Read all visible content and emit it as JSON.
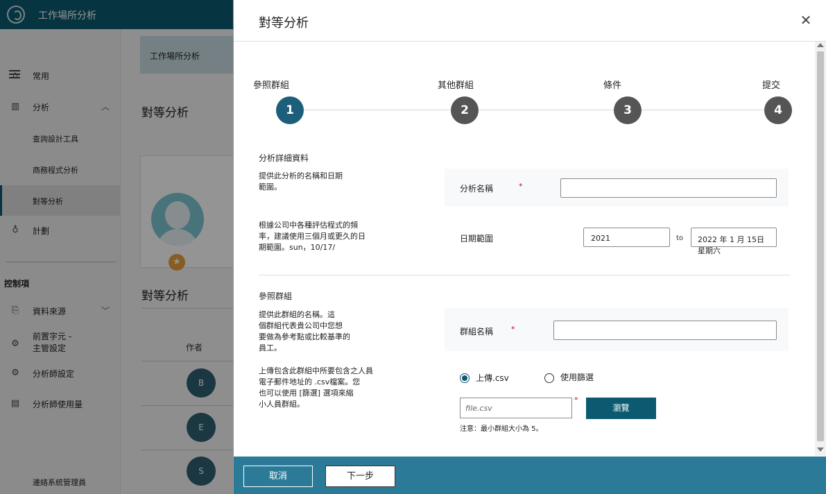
{
  "app": {
    "title": "工作場所分析"
  },
  "sidebar": {
    "items": [
      {
        "label": "常用",
        "icon": "home-icon"
      },
      {
        "label": "分析",
        "icon": "chart-icon"
      },
      {
        "label": "查詢設計工具"
      },
      {
        "label": "商務程式分析"
      },
      {
        "label": "對等分析"
      },
      {
        "label": "計劃",
        "icon": "bulb-icon"
      }
    ],
    "section_label": "控制項",
    "controls": [
      {
        "label": "資料來源",
        "icon": "data-source-icon"
      },
      {
        "label": "前置字元 -",
        "label2": "主管設定",
        "icon": "gear-icon"
      },
      {
        "label": "分析師設定",
        "icon": "gear-icon"
      },
      {
        "label": "分析師使用量",
        "icon": "report-icon"
      }
    ],
    "bottom_label": "連絡系統管理員"
  },
  "main": {
    "breadcrumb": "工作場所分析",
    "title": "對等分析",
    "subtitle": "對等分析",
    "author_header": "作者",
    "authors": [
      "B",
      "E",
      "S"
    ]
  },
  "panel": {
    "title": "對等分析",
    "steps": [
      {
        "label": "參照群組",
        "number": "1"
      },
      {
        "label": "其他群組",
        "number": "2"
      },
      {
        "label": "條件",
        "number": "3"
      },
      {
        "label": "提交",
        "number": "4"
      }
    ],
    "details": {
      "section_title": "分析詳細資料",
      "desc1_line1": "提供此分析的名稱和日期",
      "desc1_line2": "範圍。",
      "name_label": "分析名稱",
      "name_value": "",
      "desc2_line1": "根據公司中各種評估程式的頻",
      "desc2_line2": "率，建議使用三個月或更久的日",
      "desc2_line3": "期範圍。sun，10/17/",
      "date_label": "日期範圍",
      "date_start": "2021",
      "date_sep": "to",
      "date_end": "2022 年 1 月 15日星期六"
    },
    "reference": {
      "section_title": "參照群組",
      "desc_line1": "提供此群組的名稱。這",
      "desc_line2": "個群組代表貴公司中您想",
      "desc_line3": "要做為參考點或比較基準的",
      "desc_line4": "員工。",
      "group_label": "群組名稱",
      "group_value": "",
      "upload_line1": "上傳包含此群組中所要包含之人員",
      "upload_line2": "電子郵件地址的 .csv檔案。您",
      "upload_line3": "也可以使用 [篩選] 選項來縮",
      "upload_line4": "小人員群組。",
      "radio_upload": "上傳.csv",
      "radio_filter": "使用篩選",
      "file_placeholder": "file.csv",
      "browse_label": "瀏覽",
      "note": "注意：最小群組大小為 5。"
    },
    "footer": {
      "cancel": "取消",
      "next": "下一步"
    },
    "required_mark": "*"
  },
  "colors": {
    "brand": "#0b5a70",
    "active_step": "#1d5f7b",
    "inactive_step": "#555555",
    "footer": "#2b7b98"
  }
}
